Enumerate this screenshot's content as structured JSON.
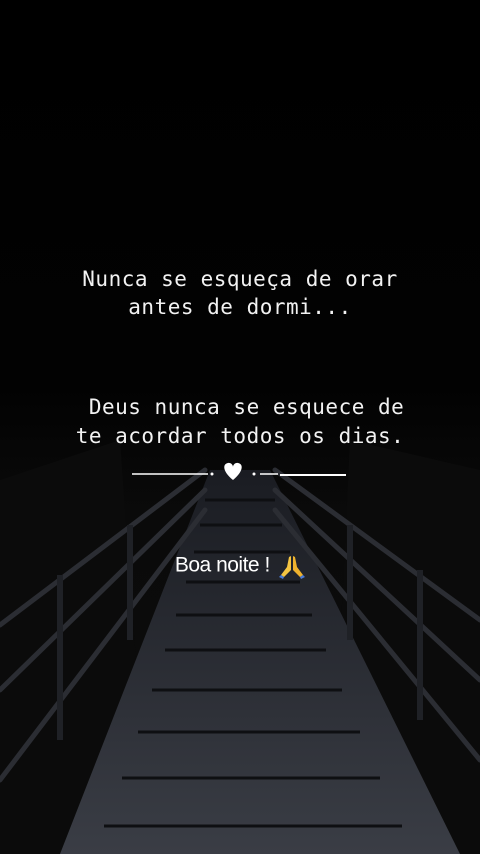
{
  "message": {
    "line1": "Nunca se esqueça de orar",
    "line2": "antes de dormi...",
    "line3": " Deus nunca se esquece de",
    "line4": "te acordar todos os dias."
  },
  "greeting": {
    "text": "Boa noite !"
  },
  "icons": {
    "divider": "heart-divider-icon",
    "greeting": "praying-hands-icon"
  },
  "colors": {
    "background": "#000000",
    "text": "#f2f2f2",
    "praying_hands": "#f5c542"
  }
}
